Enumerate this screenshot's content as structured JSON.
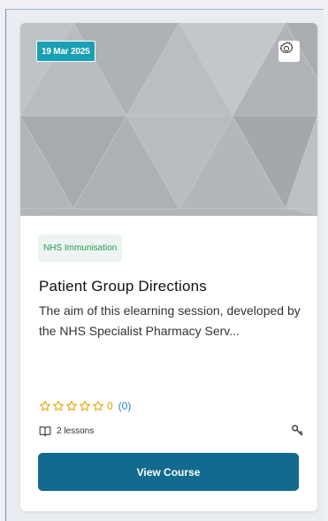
{
  "course": {
    "date": "19 Mar 2025",
    "category": "NHS Immunisation",
    "title": "Patient Group Directions",
    "description": "The aim of this elearning session, developed by the NHS Specialist Pharmacy Serv...",
    "rating_value": "0",
    "rating_count": "(0)",
    "rating_stars": 0,
    "lessons": "2 lessons",
    "view_label": "View Course"
  },
  "icons": {
    "settings": "gear-icon",
    "lessons": "book-icon",
    "access": "key-icon",
    "star": "star-outline-icon"
  },
  "colors": {
    "badge": "#1aa0b4",
    "category_text": "#1f9b52",
    "category_bg": "#eef5f0",
    "star": "#e5a000",
    "count_link": "#1b7fc3",
    "button": "#126b8e"
  }
}
